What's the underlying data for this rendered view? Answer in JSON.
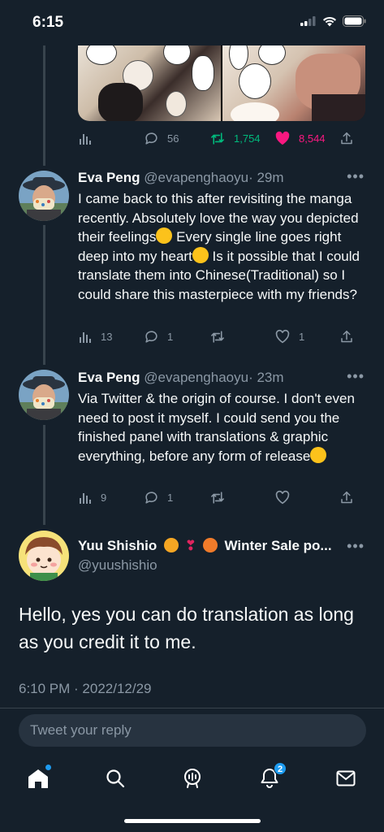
{
  "status_bar": {
    "time": "6:15"
  },
  "top_tweet": {
    "views": "",
    "replies": "56",
    "retweets": "1,754",
    "likes": "8,544"
  },
  "replies": [
    {
      "name": "Eva Peng",
      "handle": "@evapenghaoyu",
      "time": "· 29m",
      "text_parts": [
        "I came back to this after revisiting the manga recently. Absolutely love the way you depicted their feelings",
        "Every single line goes right deep into my heart",
        " Is it possible that I could translate them into Chinese(Traditional) so I could share this masterpiece with my friends?"
      ],
      "views": "13",
      "replies": "1",
      "retweets": "",
      "likes": "1"
    },
    {
      "name": "Eva Peng",
      "handle": "@evapenghaoyu",
      "time": "· 23m",
      "text_parts": [
        "Via Twitter & the origin of course. I don't even need to post it myself. I could send you the finished panel with translations & graphic everything, before any form of release"
      ],
      "views": "9",
      "replies": "1",
      "retweets": "",
      "likes": ""
    }
  ],
  "main_tweet": {
    "name": "Yuu Shishio",
    "name_suffix": "Winter Sale po...",
    "handle": "@yuushishio",
    "text": "Hello, yes you can do translation as long as you credit it to me.",
    "timestamp": "6:10 PM · 2022/12/29"
  },
  "reply_box": {
    "placeholder": "Tweet your reply"
  },
  "nav": {
    "notifications_badge": "2"
  },
  "colors": {
    "background": "#15202b",
    "accent": "#1d9bf0",
    "retweet_green": "#00ba7c",
    "like_pink": "#f91880",
    "muted": "#8b98a5"
  }
}
